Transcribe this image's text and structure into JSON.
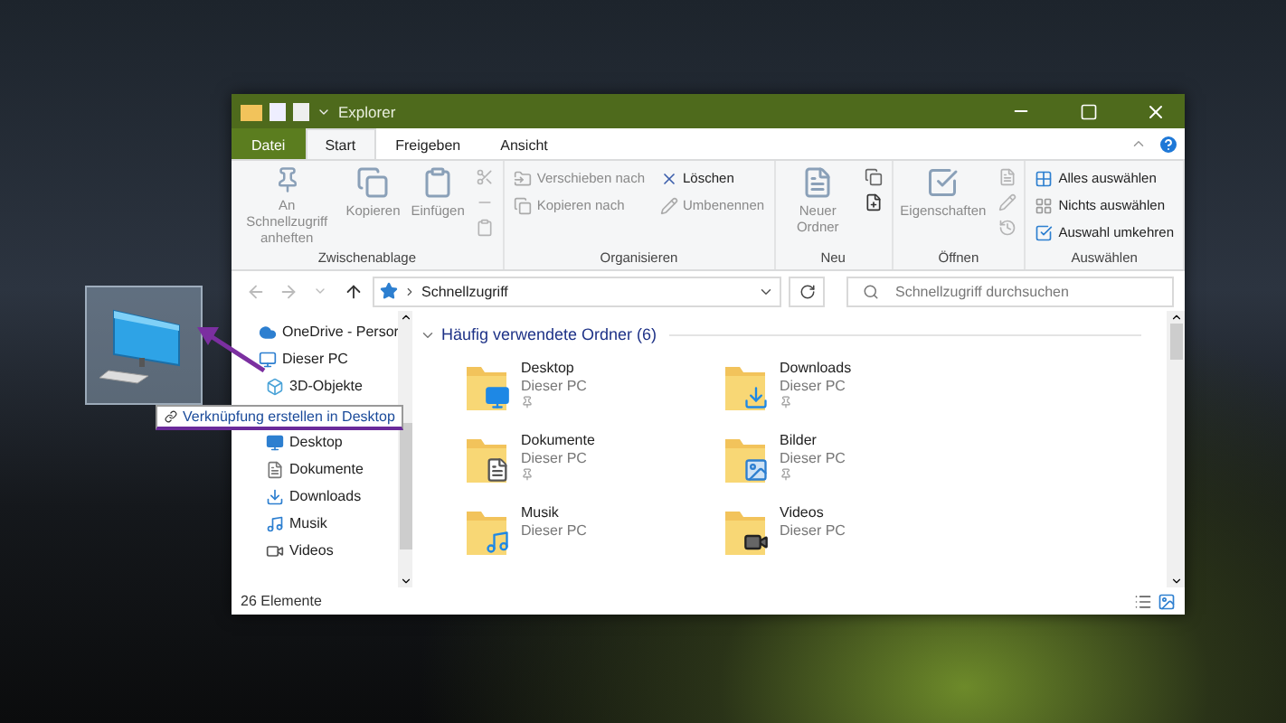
{
  "desktop": {
    "icon": {
      "selected": true
    },
    "tooltip": "Verknüpfung erstellen in Desktop"
  },
  "window": {
    "title": "Explorer"
  },
  "ribbon_tabs": [
    {
      "label": "Datei",
      "kind": "file",
      "selected": false
    },
    {
      "label": "Start",
      "kind": "tab",
      "selected": true
    },
    {
      "label": "Freigeben",
      "kind": "tab",
      "selected": false
    },
    {
      "label": "Ansicht",
      "kind": "tab",
      "selected": false
    }
  ],
  "ribbon_groups": [
    {
      "label": "Zwischenablage",
      "commands": [
        {
          "kind": "large",
          "label": "An Schnellzugriff anheften",
          "disabled": true
        },
        {
          "kind": "large",
          "label": "Kopieren",
          "disabled": true
        },
        {
          "kind": "large",
          "label": "Einfügen",
          "disabled": true
        },
        {
          "kind": "icons",
          "disabled": true
        }
      ]
    },
    {
      "label": "Organisieren",
      "commands": [
        {
          "kind": "small",
          "label": "Verschieben nach",
          "disabled": true
        },
        {
          "kind": "small",
          "label": "Kopieren nach",
          "disabled": true
        },
        {
          "kind": "small",
          "label": "Löschen",
          "disabled": false
        },
        {
          "kind": "small",
          "label": "Umbenennen",
          "disabled": true
        }
      ]
    },
    {
      "label": "Neu",
      "commands": [
        {
          "kind": "large",
          "label": "Neuer Ordner",
          "disabled": true
        },
        {
          "kind": "icons",
          "disabled": false
        }
      ]
    },
    {
      "label": "Öffnen",
      "commands": [
        {
          "kind": "large",
          "label": "Eigenschaften",
          "disabled": true
        },
        {
          "kind": "icons",
          "disabled": true
        }
      ]
    },
    {
      "label": "Auswählen",
      "commands": [
        {
          "kind": "small",
          "label": "Alles auswählen",
          "disabled": false
        },
        {
          "kind": "small",
          "label": "Nichts auswählen",
          "disabled": false
        },
        {
          "kind": "small",
          "label": "Auswahl umkehren",
          "disabled": false
        }
      ]
    }
  ],
  "address": {
    "path": "Schnellzugriff"
  },
  "search": {
    "placeholder": "Schnellzugriff durchsuchen"
  },
  "sidebar": {
    "items": [
      {
        "label": "OneDrive - Persor"
      },
      {
        "label": "Dieser PC",
        "children": [
          {
            "label": "3D-Objekte"
          },
          {
            "label": "Desktop"
          },
          {
            "label": "Dokumente"
          },
          {
            "label": "Downloads"
          },
          {
            "label": "Musik"
          },
          {
            "label": "Videos"
          }
        ]
      }
    ]
  },
  "section": {
    "title": "Häufig verwendete Ordner (6)",
    "expanded": true
  },
  "folders": [
    {
      "name": "Desktop",
      "location": "Dieser PC",
      "pinned": true
    },
    {
      "name": "Downloads",
      "location": "Dieser PC",
      "pinned": true
    },
    {
      "name": "Dokumente",
      "location": "Dieser PC",
      "pinned": true
    },
    {
      "name": "Bilder",
      "location": "Dieser PC",
      "pinned": true
    },
    {
      "name": "Musik",
      "location": "Dieser PC",
      "pinned": false
    },
    {
      "name": "Videos",
      "location": "Dieser PC",
      "pinned": false
    }
  ],
  "status_bar": {
    "text": "26 Elemente"
  }
}
